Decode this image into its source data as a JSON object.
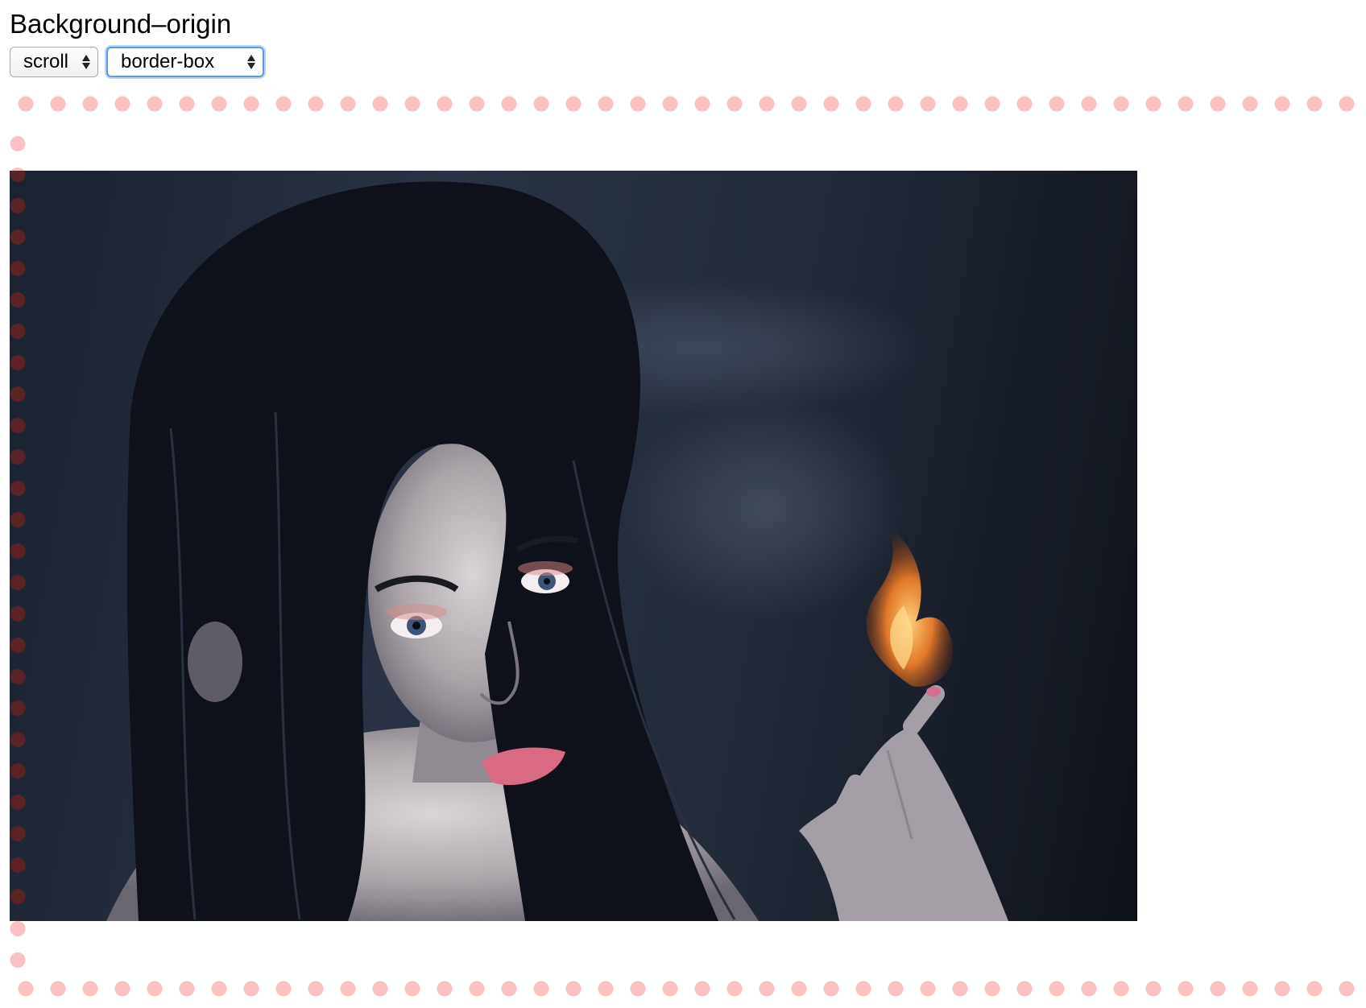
{
  "page": {
    "title": "Background–origin"
  },
  "controls": {
    "attachment": {
      "value": "scroll"
    },
    "origin": {
      "value": "border-box"
    }
  },
  "colors": {
    "dot_color": "#f9c1c1",
    "focus_ring": "#5b9ae6"
  }
}
